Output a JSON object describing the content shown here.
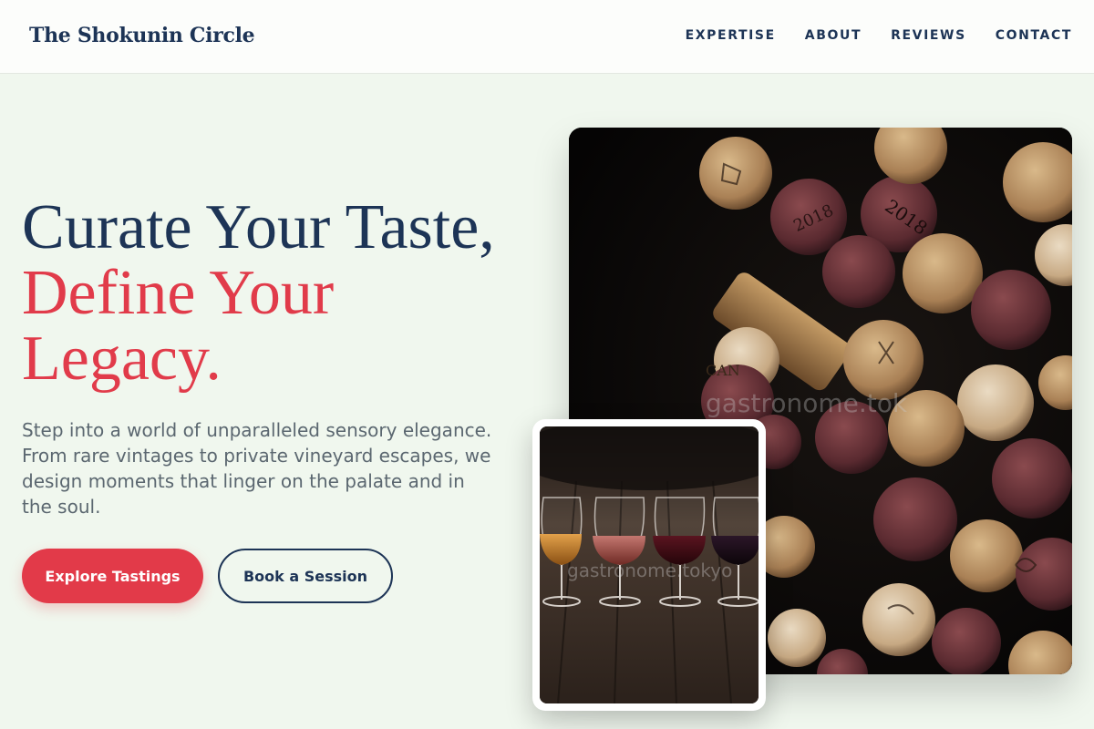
{
  "brand": {
    "name": "The Shokunin Circle"
  },
  "nav": {
    "items": [
      "EXPERTISE",
      "ABOUT",
      "REVIEWS",
      "CONTACT"
    ]
  },
  "hero": {
    "headline_line1": "Curate Your Taste,",
    "headline_line2": "Define Your",
    "headline_line3": "Legacy.",
    "subtitle": "Step into a world of unparalleled sensory elegance. From rare vintages to private vineyard escapes, we design moments that linger on the palate and in the soul.",
    "primary_button": "Explore Tastings",
    "secondary_button": "Book a Session"
  },
  "images": {
    "main_watermark": "gastronome.tok",
    "secondary_watermark": "gastronome.tokyo"
  },
  "colors": {
    "navy": "#1d3456",
    "accent_red": "#e13b4a",
    "background": "#f0f7ee"
  }
}
